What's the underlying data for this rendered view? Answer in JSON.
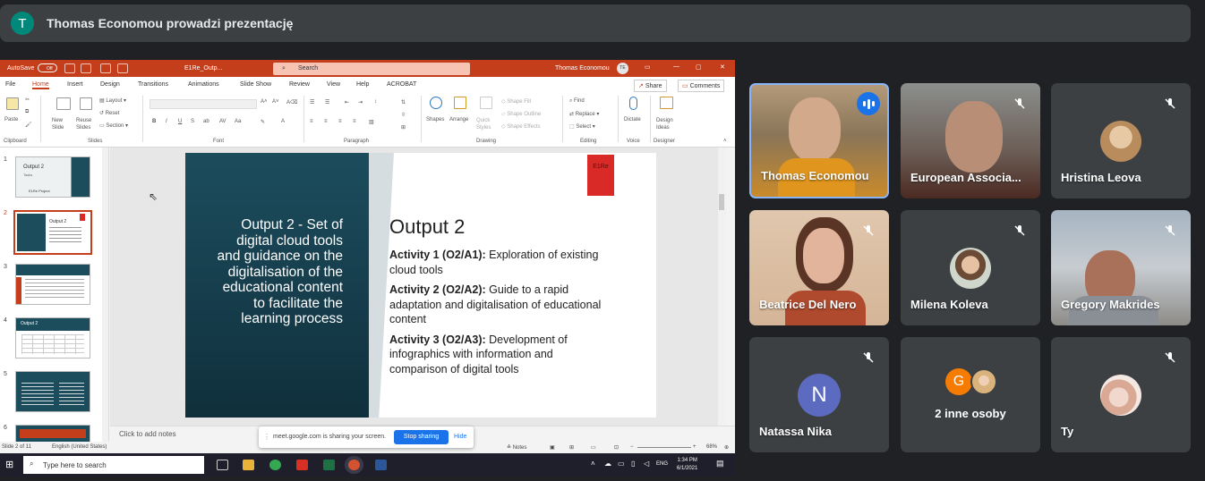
{
  "meet": {
    "presenter_initial": "T",
    "presenter_banner": "Thomas Economou prowadzi prezentację",
    "accent_color": "#1a73e8"
  },
  "ppt": {
    "autosave": "AutoSave",
    "autosave_state": "Off",
    "file_name": "E1Re_Outp...",
    "search_placeholder": "Search",
    "user": "Thomas Economou",
    "user_initials": "TE",
    "tabs": [
      "File",
      "Home",
      "Insert",
      "Design",
      "Transitions",
      "Animations",
      "Slide Show",
      "Review",
      "View",
      "Help",
      "ACROBAT"
    ],
    "share_label": "Share",
    "comments_label": "Comments",
    "ribbon": {
      "paste": "Paste",
      "clipboard": "Clipboard",
      "new_slide": "New Slide",
      "reuse_slides": "Reuse Slides",
      "layout": "Layout",
      "reset": "Reset",
      "section": "Section",
      "slides": "Slides",
      "font": "Font",
      "paragraph": "Paragraph",
      "shapes": "Shapes",
      "arrange": "Arrange",
      "quick_styles": "Quick Styles",
      "shape_fill": "Shape Fill",
      "shape_outline": "Shape Outline",
      "shape_effects": "Shape Effects",
      "drawing": "Drawing",
      "find": "Find",
      "replace": "Replace",
      "select": "Select",
      "editing": "Editing",
      "dictate": "Dictate",
      "voice": "Voice",
      "design_ideas": "Design Ideas",
      "designer": "Designer"
    },
    "thumb_numbers": [
      "1",
      "2",
      "3",
      "4",
      "5",
      "6"
    ],
    "thumb1_title": "Output 2",
    "thumb1_sub": "Tasks",
    "thumb1_footer": "E1Re Project",
    "thumb2_title": "Output 2",
    "thumb4_title": "Output 2",
    "slide": {
      "left_text": "Output 2 - Set of digital cloud tools and guidance on the digitalisation of the educational content to facilitate the learning process",
      "logo_text": "E1Re",
      "heading": "Output 2",
      "activities": [
        {
          "label": "Activity 1 (O2/A1):",
          "text": " Exploration of existing cloud tools"
        },
        {
          "label": "Activity 2 (O2/A2):",
          "text": " Guide to a rapid adaptation and digitalisation of educational content"
        },
        {
          "label": "Activity 3 (O2/A3):",
          "text": " Development of infographics with information and comparison of digital tools"
        }
      ]
    },
    "notes_placeholder": "Click to add notes",
    "status_slide": "Slide 2 of 11",
    "status_lang": "English (United States)",
    "notes_label": "Notes",
    "zoom": "68%"
  },
  "share_bar": {
    "text": "meet.google.com is sharing your screen.",
    "stop_label": "Stop sharing",
    "hide_label": "Hide"
  },
  "taskbar": {
    "search_placeholder": "Type here to search",
    "lang": "ENG",
    "time": "1:34 PM",
    "date": "6/1/2021"
  },
  "participants": [
    {
      "name": "Thomas Economou"
    },
    {
      "name": "European Associa..."
    },
    {
      "name": "Hristina Leova"
    },
    {
      "name": "Beatrice Del Nero"
    },
    {
      "name": "Milena Koleva"
    },
    {
      "name": "Gregory Makrides"
    },
    {
      "name": "Natassa Nika",
      "initial": "N"
    },
    {
      "name": "2 inne osoby",
      "initial": "G"
    },
    {
      "name": "Ty"
    }
  ]
}
